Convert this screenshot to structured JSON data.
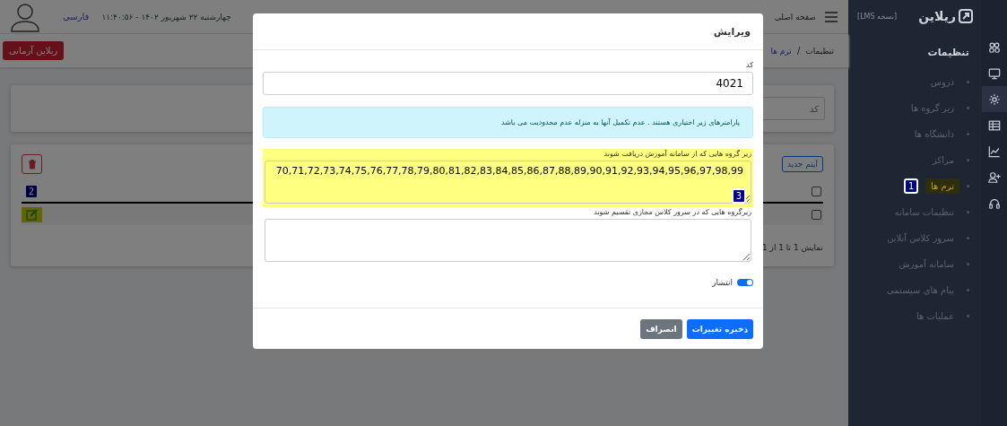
{
  "sidebar": {
    "logo": "ریلاین",
    "version": "[نسخه LMS]",
    "heading": "تنظیمات",
    "rail": [
      {
        "selected": false
      },
      {
        "selected": false
      },
      {
        "selected": true
      },
      {
        "selected": false
      },
      {
        "selected": false
      },
      {
        "selected": false
      },
      {
        "selected": false
      }
    ],
    "items": [
      {
        "label": "دروس",
        "selected": false
      },
      {
        "label": "زیر گروه ها",
        "selected": false
      },
      {
        "label": "دانشگاه ها",
        "selected": false
      },
      {
        "label": "مراکز",
        "selected": false
      },
      {
        "label": "ترم ها",
        "selected": true,
        "annotation": "1"
      },
      {
        "label": "تنظیمات سامانه",
        "selected": false
      },
      {
        "label": "سرور کلاس آنلاین",
        "selected": false
      },
      {
        "label": "سامانه آموزش",
        "selected": false
      },
      {
        "label": "پیام های سیستمی",
        "selected": false
      },
      {
        "label": "عملیات ها",
        "selected": false
      }
    ]
  },
  "header": {
    "nav": "صفحه اصلی",
    "datetime": "چهارشنبه ۲۲ شهریور ۱۴۰۲ - ۱۱:۴۰:۵۶",
    "language": "فارسی"
  },
  "breadcrumb": [
    "تنظیمات",
    "ترم ها"
  ],
  "breadcrumb_separator": "/",
  "org_button": "ریلاین آرمانی",
  "filter": {
    "placeholder": "کد"
  },
  "table": {
    "new_button": "آیتم جدید",
    "header_checked": false,
    "rows": [
      {
        "checked": false,
        "annotation": "2"
      }
    ],
    "footer": "نمایش 1 تا 1 از 1"
  },
  "modal": {
    "title": "ویرایش",
    "code_label": "کد",
    "code_value": "4021",
    "alert": "پارامترهای زیر اختیاری هستند . عدم تکمیل آنها به منزله عدم محدودیت می باشد",
    "fields": [
      {
        "label": "زیر گروه هایی که از سامانه آموزش دریافت شوند",
        "value": "70,71,72,73,74,75,76,77,78,79,80,81,82,83,84,85,86,87,88,89,90,91,92,93,94,95,96,97,98,99",
        "annotation": "3"
      },
      {
        "label": "زیرگروه هایی که در سرور کلاس مجازی تقسیم شوند"
      }
    ],
    "publish": {
      "label": "انتشار",
      "on": true
    },
    "buttons": [
      {
        "label": "ذخیره تغییرات",
        "kind": "primary"
      },
      {
        "label": "انصراف",
        "kind": "secondary"
      }
    ]
  }
}
